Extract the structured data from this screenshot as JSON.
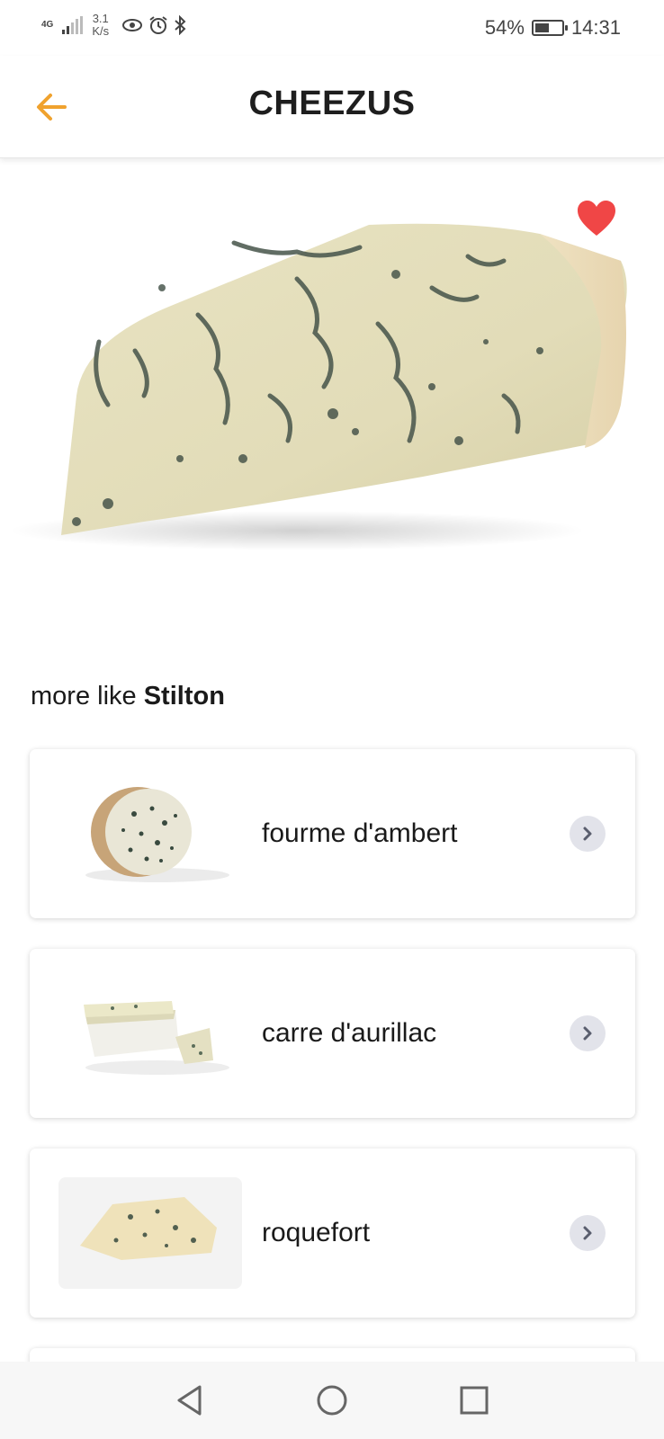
{
  "status_bar": {
    "network_type": "4G",
    "speed_value": "3.1",
    "speed_unit": "K/s",
    "battery_percent": "54%",
    "battery_level": 0.54,
    "time": "14:31"
  },
  "header": {
    "title": "CHEEZUS",
    "back_icon": "arrow-left-icon",
    "accent_color": "#f0a22e"
  },
  "hero": {
    "image_name": "stilton-image",
    "favorite_icon": "heart-icon",
    "favorite_color": "#f04646"
  },
  "related": {
    "prefix": "more like",
    "cheese_name": "Stilton",
    "items": [
      {
        "name": "fourme d'ambert"
      },
      {
        "name": "carre d'aurillac"
      },
      {
        "name": "roquefort"
      }
    ]
  },
  "nav_bar": {
    "back_icon": "triangle-back-icon",
    "home_icon": "circle-home-icon",
    "recents_icon": "square-recents-icon"
  }
}
